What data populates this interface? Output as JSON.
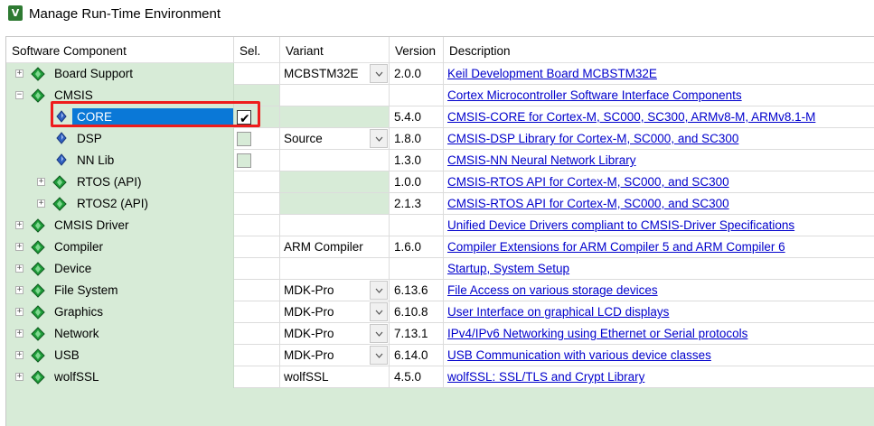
{
  "window": {
    "title": "Manage Run-Time Environment",
    "app_icon_glyph": "V"
  },
  "columns": {
    "component": "Software Component",
    "sel": "Sel.",
    "variant": "Variant",
    "version": "Version",
    "description": "Description"
  },
  "colors": {
    "tree_green": "#d7ebd7",
    "selection_blue": "#0a78d7",
    "link": "#0000cc",
    "highlight_red": "#ee1c1c",
    "gem_green": "#1f9d3a",
    "gem_blue": "#3060c0"
  },
  "rows": [
    {
      "name": "Board Support",
      "variant": "MCBSTM32E",
      "version": "2.0.0",
      "description": "Keil Development Board MCBSTM32E"
    },
    {
      "name": "CMSIS",
      "variant": "",
      "version": "",
      "description": "Cortex Microcontroller Software Interface Components"
    },
    {
      "name": "CORE",
      "variant": "",
      "version": "5.4.0",
      "description": "CMSIS-CORE for Cortex-M, SC000, SC300, ARMv8-M, ARMv8.1-M"
    },
    {
      "name": "DSP",
      "variant": "Source",
      "version": "1.8.0",
      "description": "CMSIS-DSP Library for Cortex-M, SC000, and SC300"
    },
    {
      "name": "NN Lib",
      "variant": "",
      "version": "1.3.0",
      "description": "CMSIS-NN Neural Network Library"
    },
    {
      "name": "RTOS (API)",
      "variant": "",
      "version": "1.0.0",
      "description": "CMSIS-RTOS API for Cortex-M, SC000, and SC300"
    },
    {
      "name": "RTOS2 (API)",
      "variant": "",
      "version": "2.1.3",
      "description": "CMSIS-RTOS API for Cortex-M, SC000, and SC300"
    },
    {
      "name": "CMSIS Driver",
      "variant": "",
      "version": "",
      "description": "Unified Device Drivers compliant to CMSIS-Driver Specifications"
    },
    {
      "name": "Compiler",
      "variant": "ARM Compiler",
      "version": "1.6.0",
      "description": "Compiler Extensions for ARM Compiler 5 and ARM Compiler 6"
    },
    {
      "name": "Device",
      "variant": "",
      "version": "",
      "description": "Startup, System Setup"
    },
    {
      "name": "File System",
      "variant": "MDK-Pro",
      "version": "6.13.6",
      "description": "File Access on various storage devices"
    },
    {
      "name": "Graphics",
      "variant": "MDK-Pro",
      "version": "6.10.8",
      "description": "User Interface on graphical LCD displays"
    },
    {
      "name": "Network",
      "variant": "MDK-Pro",
      "version": "7.13.1",
      "description": "IPv4/IPv6 Networking using Ethernet or Serial protocols"
    },
    {
      "name": "USB",
      "variant": "MDK-Pro",
      "version": "6.14.0",
      "description": "USB Communication with various device classes"
    },
    {
      "name": "wolfSSL",
      "variant": "wolfSSL",
      "version": "4.5.0",
      "description": "wolfSSL: SSL/TLS and Crypt Library"
    }
  ],
  "tree_state": {
    "CMSIS": "expanded",
    "CORE_selected": true,
    "CORE_checked": true
  }
}
